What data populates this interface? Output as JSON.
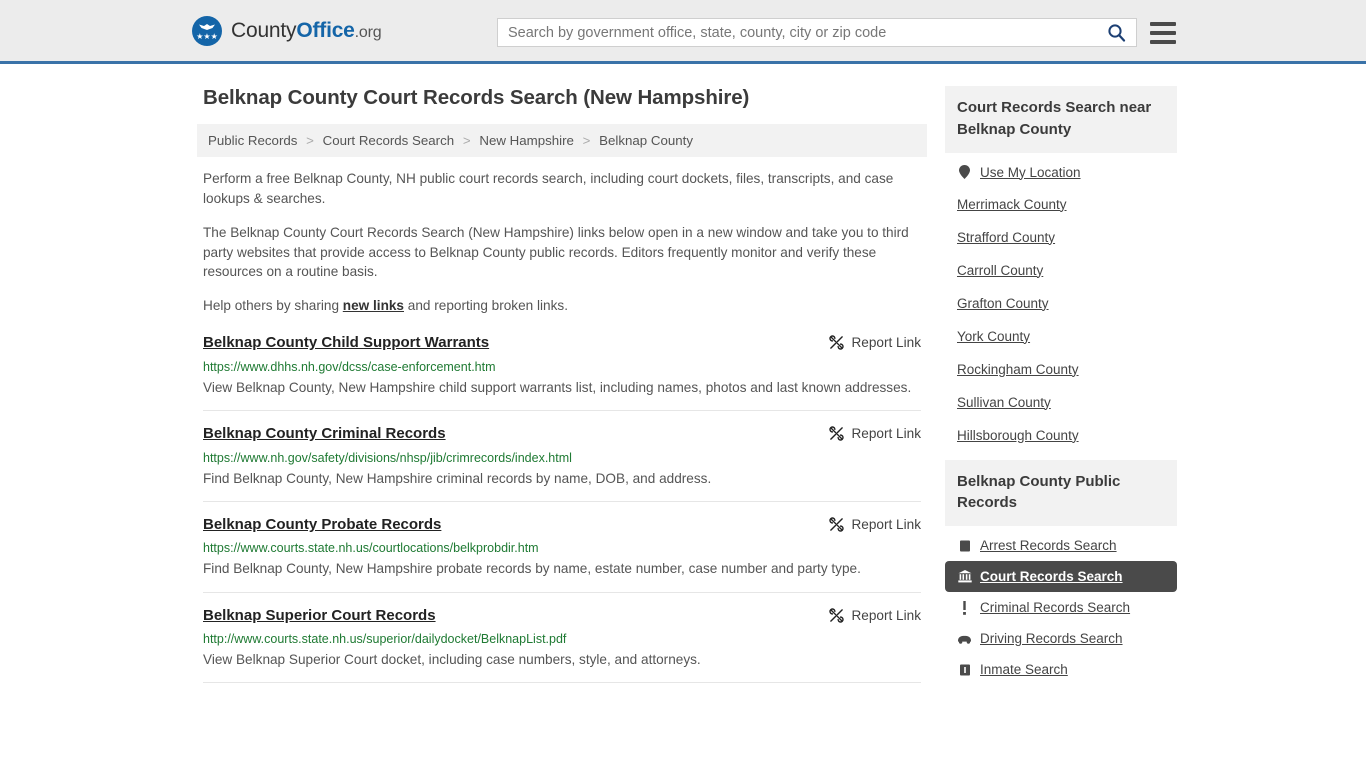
{
  "header": {
    "logo": {
      "part1": "County",
      "part2": "Office",
      "part3": ".org",
      "icon": "eagle-shield-icon",
      "stars": "★★★"
    },
    "search": {
      "placeholder": "Search by government office, state, county, city or zip code",
      "value": "",
      "search_icon": "search-icon",
      "menu_icon": "hamburger-menu-icon"
    },
    "accent_color": "#3a72a8",
    "background_color": "#ececec"
  },
  "main": {
    "title": "Belknap County Court Records Search (New Hampshire)",
    "breadcrumb": [
      {
        "label": "Public Records"
      },
      {
        "label": "Court Records Search"
      },
      {
        "label": "New Hampshire"
      },
      {
        "label": "Belknap County"
      }
    ],
    "breadcrumb_separator": ">",
    "intro": {
      "p1": "Perform a free Belknap County, NH public court records search, including court dockets, files, transcripts, and case lookups & searches.",
      "p2": "The Belknap County Court Records Search (New Hampshire) links below open in a new window and take you to third party websites that provide access to Belknap County public records. Editors frequently monitor and verify these resources on a routine basis.",
      "p3_before": "Help others by sharing ",
      "p3_link": "new links",
      "p3_after": " and reporting broken links."
    },
    "report_link_label": "Report Link",
    "report_link_icon": "broken-link-icon",
    "results": [
      {
        "title": "Belknap County Child Support Warrants",
        "url": "https://www.dhhs.nh.gov/dcss/case-enforcement.htm",
        "description": "View Belknap County, New Hampshire child support warrants list, including names, photos and last known addresses."
      },
      {
        "title": "Belknap County Criminal Records",
        "url": "https://www.nh.gov/safety/divisions/nhsp/jib/crimrecords/index.html",
        "description": "Find Belknap County, New Hampshire criminal records by name, DOB, and address."
      },
      {
        "title": "Belknap County Probate Records",
        "url": "https://www.courts.state.nh.us/courtlocations/belkprobdir.htm",
        "description": "Find Belknap County, New Hampshire probate records by name, estate number, case number and party type."
      },
      {
        "title": "Belknap Superior Court Records",
        "url": "http://www.courts.state.nh.us/superior/dailydocket/BelknapList.pdf",
        "description": "View Belknap Superior Court docket, including case numbers, style, and attorneys."
      }
    ]
  },
  "sidebar": {
    "nearby": {
      "heading": "Court Records Search near Belknap County",
      "use_my_location": {
        "label": "Use My Location",
        "icon": "map-pin-icon"
      },
      "counties": [
        "Merrimack County",
        "Strafford County",
        "Carroll County",
        "Grafton County",
        "York County",
        "Rockingham County",
        "Sullivan County",
        "Hillsborough County"
      ]
    },
    "public_records": {
      "heading": "Belknap County Public Records",
      "items": [
        {
          "label": "Arrest Records Search",
          "icon": "fingerprint-icon",
          "active": false
        },
        {
          "label": "Court Records Search",
          "icon": "courthouse-icon",
          "active": true
        },
        {
          "label": "Criminal Records Search",
          "icon": "exclamation-icon",
          "active": false
        },
        {
          "label": "Driving Records Search",
          "icon": "car-icon",
          "active": false
        },
        {
          "label": "Inmate Search",
          "icon": "jail-icon",
          "active": false
        }
      ]
    }
  }
}
